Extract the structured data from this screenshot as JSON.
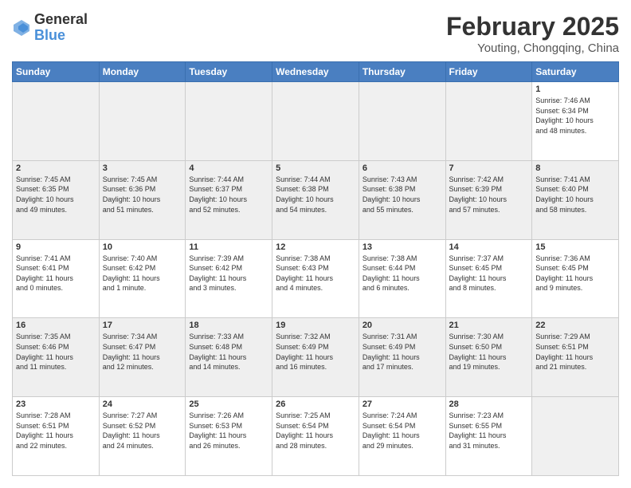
{
  "header": {
    "logo_line1": "General",
    "logo_line2": "Blue",
    "title": "February 2025",
    "subtitle": "Youting, Chongqing, China"
  },
  "weekdays": [
    "Sunday",
    "Monday",
    "Tuesday",
    "Wednesday",
    "Thursday",
    "Friday",
    "Saturday"
  ],
  "weeks": [
    [
      {
        "day": "",
        "info": ""
      },
      {
        "day": "",
        "info": ""
      },
      {
        "day": "",
        "info": ""
      },
      {
        "day": "",
        "info": ""
      },
      {
        "day": "",
        "info": ""
      },
      {
        "day": "",
        "info": ""
      },
      {
        "day": "1",
        "info": "Sunrise: 7:46 AM\nSunset: 6:34 PM\nDaylight: 10 hours\nand 48 minutes."
      }
    ],
    [
      {
        "day": "2",
        "info": "Sunrise: 7:45 AM\nSunset: 6:35 PM\nDaylight: 10 hours\nand 49 minutes."
      },
      {
        "day": "3",
        "info": "Sunrise: 7:45 AM\nSunset: 6:36 PM\nDaylight: 10 hours\nand 51 minutes."
      },
      {
        "day": "4",
        "info": "Sunrise: 7:44 AM\nSunset: 6:37 PM\nDaylight: 10 hours\nand 52 minutes."
      },
      {
        "day": "5",
        "info": "Sunrise: 7:44 AM\nSunset: 6:38 PM\nDaylight: 10 hours\nand 54 minutes."
      },
      {
        "day": "6",
        "info": "Sunrise: 7:43 AM\nSunset: 6:38 PM\nDaylight: 10 hours\nand 55 minutes."
      },
      {
        "day": "7",
        "info": "Sunrise: 7:42 AM\nSunset: 6:39 PM\nDaylight: 10 hours\nand 57 minutes."
      },
      {
        "day": "8",
        "info": "Sunrise: 7:41 AM\nSunset: 6:40 PM\nDaylight: 10 hours\nand 58 minutes."
      }
    ],
    [
      {
        "day": "9",
        "info": "Sunrise: 7:41 AM\nSunset: 6:41 PM\nDaylight: 11 hours\nand 0 minutes."
      },
      {
        "day": "10",
        "info": "Sunrise: 7:40 AM\nSunset: 6:42 PM\nDaylight: 11 hours\nand 1 minute."
      },
      {
        "day": "11",
        "info": "Sunrise: 7:39 AM\nSunset: 6:42 PM\nDaylight: 11 hours\nand 3 minutes."
      },
      {
        "day": "12",
        "info": "Sunrise: 7:38 AM\nSunset: 6:43 PM\nDaylight: 11 hours\nand 4 minutes."
      },
      {
        "day": "13",
        "info": "Sunrise: 7:38 AM\nSunset: 6:44 PM\nDaylight: 11 hours\nand 6 minutes."
      },
      {
        "day": "14",
        "info": "Sunrise: 7:37 AM\nSunset: 6:45 PM\nDaylight: 11 hours\nand 8 minutes."
      },
      {
        "day": "15",
        "info": "Sunrise: 7:36 AM\nSunset: 6:45 PM\nDaylight: 11 hours\nand 9 minutes."
      }
    ],
    [
      {
        "day": "16",
        "info": "Sunrise: 7:35 AM\nSunset: 6:46 PM\nDaylight: 11 hours\nand 11 minutes."
      },
      {
        "day": "17",
        "info": "Sunrise: 7:34 AM\nSunset: 6:47 PM\nDaylight: 11 hours\nand 12 minutes."
      },
      {
        "day": "18",
        "info": "Sunrise: 7:33 AM\nSunset: 6:48 PM\nDaylight: 11 hours\nand 14 minutes."
      },
      {
        "day": "19",
        "info": "Sunrise: 7:32 AM\nSunset: 6:49 PM\nDaylight: 11 hours\nand 16 minutes."
      },
      {
        "day": "20",
        "info": "Sunrise: 7:31 AM\nSunset: 6:49 PM\nDaylight: 11 hours\nand 17 minutes."
      },
      {
        "day": "21",
        "info": "Sunrise: 7:30 AM\nSunset: 6:50 PM\nDaylight: 11 hours\nand 19 minutes."
      },
      {
        "day": "22",
        "info": "Sunrise: 7:29 AM\nSunset: 6:51 PM\nDaylight: 11 hours\nand 21 minutes."
      }
    ],
    [
      {
        "day": "23",
        "info": "Sunrise: 7:28 AM\nSunset: 6:51 PM\nDaylight: 11 hours\nand 22 minutes."
      },
      {
        "day": "24",
        "info": "Sunrise: 7:27 AM\nSunset: 6:52 PM\nDaylight: 11 hours\nand 24 minutes."
      },
      {
        "day": "25",
        "info": "Sunrise: 7:26 AM\nSunset: 6:53 PM\nDaylight: 11 hours\nand 26 minutes."
      },
      {
        "day": "26",
        "info": "Sunrise: 7:25 AM\nSunset: 6:54 PM\nDaylight: 11 hours\nand 28 minutes."
      },
      {
        "day": "27",
        "info": "Sunrise: 7:24 AM\nSunset: 6:54 PM\nDaylight: 11 hours\nand 29 minutes."
      },
      {
        "day": "28",
        "info": "Sunrise: 7:23 AM\nSunset: 6:55 PM\nDaylight: 11 hours\nand 31 minutes."
      },
      {
        "day": "",
        "info": ""
      }
    ]
  ]
}
